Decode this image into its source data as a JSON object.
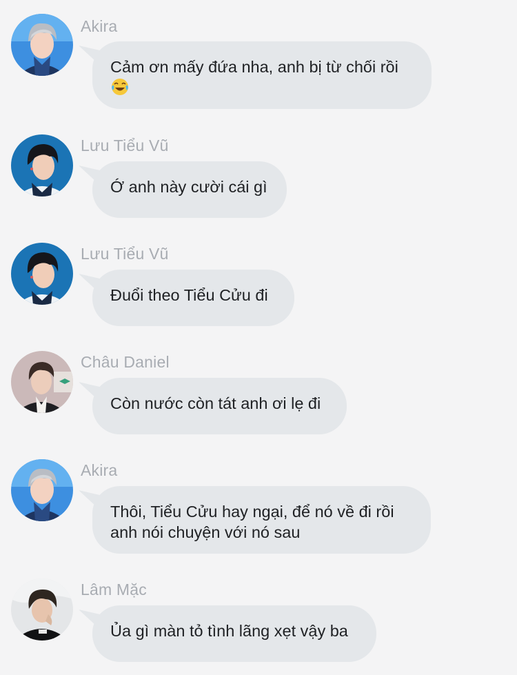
{
  "messages": [
    {
      "sender": "Akira",
      "avatar": "akira-avatar",
      "line1": "Cảm ơn mấy đứa nha, anh bị từ chối rồi",
      "line2": "",
      "emoji": "face-with-tears-of-joy"
    },
    {
      "sender": "Lưu Tiểu Vũ",
      "avatar": "luu-tieu-vu-avatar",
      "line1": "Ớ anh này cười cái gì",
      "line2": ""
    },
    {
      "sender": "Lưu Tiểu Vũ",
      "avatar": "luu-tieu-vu-avatar",
      "line1": "Đuổi theo Tiểu Cửu đi",
      "line2": ""
    },
    {
      "sender": "Châu Daniel",
      "avatar": "chau-daniel-avatar",
      "line1": "Còn nước còn tát anh ơi lẹ đi",
      "line2": ""
    },
    {
      "sender": "Akira",
      "avatar": "akira-avatar",
      "line1": "Thôi, Tiểu Cửu hay ngại, để nó về đi rồi",
      "line2": "anh nói chuyện với nó sau"
    },
    {
      "sender": "Lâm Mặc",
      "avatar": "lam-mac-avatar",
      "line1": "Ủa gì màn tỏ tình lãng xẹt vậy ba",
      "line2": ""
    }
  ],
  "colors": {
    "background": "#f4f4f5",
    "bubble": "#e4e7ea",
    "sender_name": "#a8acb2",
    "text": "#1f2124"
  }
}
